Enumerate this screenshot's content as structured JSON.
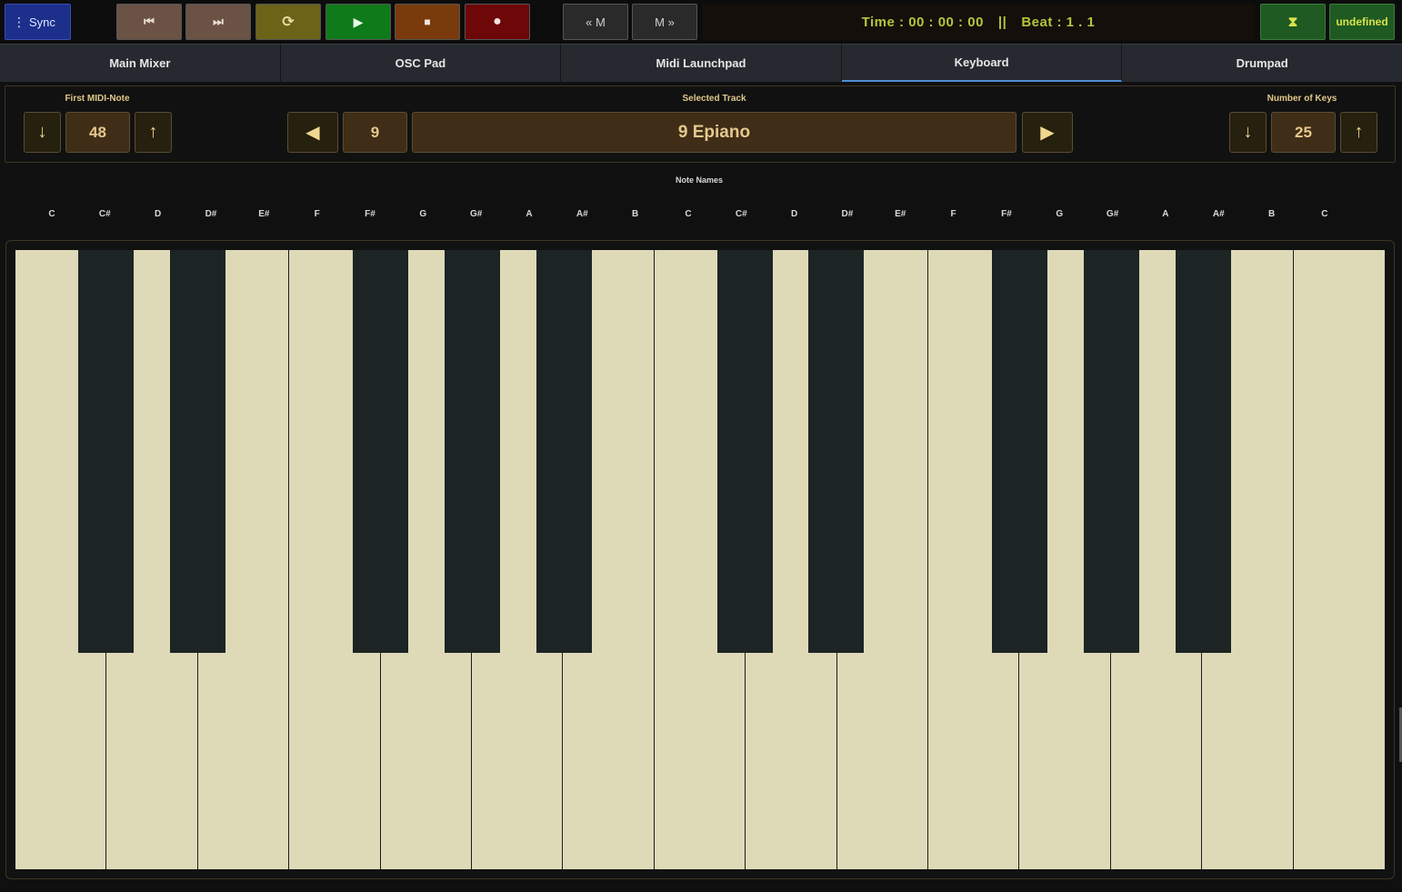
{
  "topbar": {
    "sync_label": "Sync",
    "sync_dots": "⋮",
    "buttons": {
      "prev_icon": "⏮",
      "next_icon": "⏭",
      "loop_icon": "⟳",
      "play_icon": "▶",
      "stop_icon": "■",
      "record_icon": "●",
      "marker_prev_label": "« M",
      "marker_next_label": "M »",
      "timer_icon": "⧗",
      "status_label": "undefined"
    },
    "display": {
      "time": "Time : 00 : 00 : 00",
      "separator": "||",
      "beat": "Beat : 1 . 1"
    },
    "colors": {
      "sync": "#1c2f8a",
      "transport_nav": "#6a5244",
      "loop": "#6b6418",
      "play": "#0f7a1a",
      "stop": "#7a3b0c",
      "record": "#6e0707",
      "display_text": "#b7c43c"
    }
  },
  "tabs": [
    {
      "label": "Main Mixer",
      "active": false
    },
    {
      "label": "OSC Pad",
      "active": false
    },
    {
      "label": "Midi Launchpad",
      "active": false
    },
    {
      "label": "Keyboard",
      "active": true
    },
    {
      "label": "Drumpad",
      "active": false
    }
  ],
  "controls": {
    "first_midi_note": {
      "label": "First MIDI-Note",
      "value": "48",
      "down_icon": "↓",
      "up_icon": "↑"
    },
    "selected_track": {
      "label": "Selected Track",
      "number": "9",
      "name": "9 Epiano",
      "prev_icon": "◀",
      "next_icon": "▶"
    },
    "number_of_keys": {
      "label": "Number of Keys",
      "value": "25",
      "down_icon": "↓",
      "up_icon": "↑"
    }
  },
  "note_names": {
    "title": "Note Names",
    "notes": [
      "C",
      "C#",
      "D",
      "D#",
      "E#",
      "F",
      "F#",
      "G",
      "G#",
      "A",
      "A#",
      "B",
      "C",
      "C#",
      "D",
      "D#",
      "E#",
      "F",
      "F#",
      "G",
      "G#",
      "A",
      "A#",
      "B",
      "C"
    ]
  },
  "keyboard": {
    "key_count": 25,
    "white_key_color": "#dedab8",
    "black_key_color": "#1c2424"
  }
}
